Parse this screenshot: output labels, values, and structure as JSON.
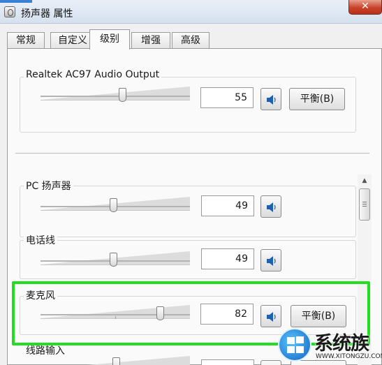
{
  "window": {
    "title": "扬声器 属性",
    "close_label": "✕"
  },
  "tabs": [
    {
      "label": "常规"
    },
    {
      "label": "自定义"
    },
    {
      "label": "级别"
    },
    {
      "label": "增强"
    },
    {
      "label": "高级"
    }
  ],
  "active_tab": "级别",
  "master": {
    "label": "Realtek AC97 Audio Output",
    "value": "55",
    "level_percent": 55,
    "balance_label": "平衡(B)"
  },
  "channels": [
    {
      "label": "PC 扬声器",
      "value": "49",
      "level_percent": 49
    },
    {
      "label": "电话线",
      "value": "49",
      "level_percent": 49
    },
    {
      "label": "麦克风",
      "value": "82",
      "level_percent": 82,
      "balance_label": "平衡(B)",
      "highlighted": true
    },
    {
      "label": "线路输入"
    }
  ],
  "watermark": {
    "name": "系统族",
    "url": "WWW.XITONGZU.COM"
  },
  "colors": {
    "highlight": "#22dd22",
    "close_button": "#c8432a",
    "speaker_icon": "#1e5fb4"
  }
}
